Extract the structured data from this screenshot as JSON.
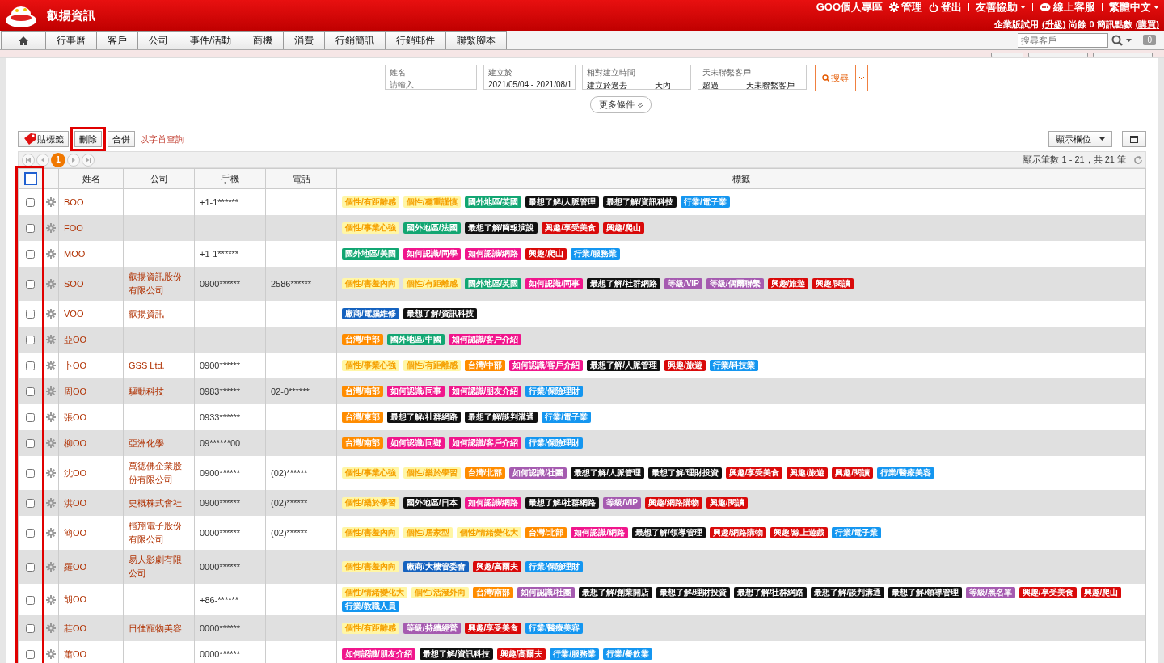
{
  "header": {
    "title": "叡揚資訊",
    "links": [
      {
        "label": "GOO個人專區",
        "kind": "link"
      },
      {
        "label": "管理",
        "kind": "link"
      },
      {
        "label": "登出",
        "kind": "link"
      },
      {
        "label": "友善協助",
        "kind": "dropdown"
      },
      {
        "label": "線上客服",
        "kind": "link"
      },
      {
        "label": "繁體中文",
        "kind": "dropdown"
      }
    ],
    "account": [
      {
        "label": "企業版試用",
        "link": false
      },
      {
        "label": "(升級)",
        "link": true
      },
      {
        "label": "尚餘 0 簡訊點數",
        "link": false
      },
      {
        "label": "(購買)",
        "link": true
      }
    ]
  },
  "nav": {
    "tabs": [
      {
        "label": "行事曆",
        "selected": false
      },
      {
        "label": "客戶",
        "selected": false
      },
      {
        "label": "公司",
        "selected": false
      },
      {
        "label": "事件/活動",
        "selected": false
      },
      {
        "label": "商機",
        "selected": false
      },
      {
        "label": "消費",
        "selected": false
      },
      {
        "label": "行銷簡訊",
        "selected": false
      },
      {
        "label": "行銷郵件",
        "selected": false
      },
      {
        "label": "聯繫腳本",
        "selected": false
      }
    ],
    "search": {
      "placeholder": "搜尋客戶"
    },
    "badge": "0"
  },
  "filters": [
    {
      "kind": "text",
      "label": "姓名",
      "placeholder": "請輸入"
    },
    {
      "kind": "value",
      "label": "建立於",
      "value": "2021/05/04 - 2021/08/1"
    },
    {
      "kind": "blank",
      "label": "相對建立時間",
      "before": "建立於過去",
      "after": "天內"
    },
    {
      "kind": "blank",
      "label": "天未聯繫客戶",
      "before": "超過",
      "after": "天未聯繫客戶"
    }
  ],
  "search_button": "搜尋",
  "more_conditions": "更多條件",
  "toolbar": {
    "buttons": [
      {
        "label": "貼標籤",
        "highlighted": false
      },
      {
        "label": "刪除",
        "highlighted": true
      },
      {
        "label": "合併",
        "highlighted": false
      }
    ],
    "link": "以字首查詢",
    "columns_button": "顯示欄位"
  },
  "pager": {
    "pages": [
      {
        "label": "1",
        "selected": true
      }
    ],
    "summary": "顯示筆數 1 - 21，共 21 筆"
  },
  "table": {
    "highlight_checkbox_column": true,
    "select_all_checked": false,
    "columns": [
      "姓名",
      "公司",
      "手機",
      "電話",
      "標籤"
    ],
    "rows": [
      {
        "checked": false,
        "name": "BOO",
        "company": "",
        "mobile": "+1-1******",
        "phone": "",
        "tags": [
          {
            "label": "個性/有距離感",
            "color": "#fff6a6"
          },
          {
            "label": "個性/穩重謹慎",
            "color": "#fff6a6"
          },
          {
            "label": "國外地區/英國",
            "color": "#12a672"
          },
          {
            "label": "最想了解/人脈管理",
            "color": "#111111"
          },
          {
            "label": "最想了解/資訊科技",
            "color": "#111111"
          },
          {
            "label": "行業/電子業",
            "color": "#1496f0"
          }
        ]
      },
      {
        "checked": false,
        "name": "FOO",
        "company": "",
        "mobile": "",
        "phone": "",
        "tags": [
          {
            "label": "個性/事業心強",
            "color": "#fff6a6"
          },
          {
            "label": "國外地區/法國",
            "color": "#12a672"
          },
          {
            "label": "最想了解/簡報演說",
            "color": "#111111"
          },
          {
            "label": "興趣/享受美食",
            "color": "#d90a0a"
          },
          {
            "label": "興趣/爬山",
            "color": "#d90a0a"
          }
        ]
      },
      {
        "checked": false,
        "name": "MOO",
        "company": "",
        "mobile": "+1-1******",
        "phone": "",
        "tags": [
          {
            "label": "國外地區/美國",
            "color": "#12a672"
          },
          {
            "label": "如何認識/同學",
            "color": "#f0168c"
          },
          {
            "label": "如何認識/網路",
            "color": "#f0168c"
          },
          {
            "label": "興趣/爬山",
            "color": "#d90a0a"
          },
          {
            "label": "行業/服務業",
            "color": "#1496f0"
          }
        ]
      },
      {
        "checked": false,
        "name": "SOO",
        "company": "叡揚資訊股份有限公司",
        "mobile": "0900******",
        "phone": "2586******",
        "tags": [
          {
            "label": "個性/害羞內向",
            "color": "#fff6a6"
          },
          {
            "label": "個性/有距離感",
            "color": "#fff6a6"
          },
          {
            "label": "國外地區/英國",
            "color": "#12a672"
          },
          {
            "label": "如何認識/同事",
            "color": "#f0168c"
          },
          {
            "label": "最想了解/社群網路",
            "color": "#111111"
          },
          {
            "label": "等級/VIP",
            "color": "#a55bb0"
          },
          {
            "label": "等級/偶爾聯繫",
            "color": "#a55bb0"
          },
          {
            "label": "興趣/旅遊",
            "color": "#d90a0a"
          },
          {
            "label": "興趣/閱讀",
            "color": "#d90a0a"
          }
        ]
      },
      {
        "checked": false,
        "name": "VOO",
        "company": "叡揚資訊",
        "mobile": "",
        "phone": "",
        "tags": [
          {
            "label": "廠商/電腦維修",
            "color": "#1562bf"
          },
          {
            "label": "最想了解/資訊科技",
            "color": "#111111"
          }
        ]
      },
      {
        "checked": false,
        "name": "亞OO",
        "company": "",
        "mobile": "",
        "phone": "",
        "tags": [
          {
            "label": "台灣/中部",
            "color": "#ff8c00"
          },
          {
            "label": "國外地區/中國",
            "color": "#12a672"
          },
          {
            "label": "如何認識/客戶介紹",
            "color": "#f0168c"
          }
        ]
      },
      {
        "checked": false,
        "name": "卜OO",
        "company": "GSS Ltd.",
        "mobile": "0900******",
        "phone": "",
        "tags": [
          {
            "label": "個性/事業心強",
            "color": "#fff6a6"
          },
          {
            "label": "個性/有距離感",
            "color": "#fff6a6"
          },
          {
            "label": "台灣/中部",
            "color": "#ff8c00"
          },
          {
            "label": "如何認識/客戶介紹",
            "color": "#f0168c"
          },
          {
            "label": "最想了解/人脈管理",
            "color": "#111111"
          },
          {
            "label": "興趣/旅遊",
            "color": "#d90a0a"
          },
          {
            "label": "行業/科技業",
            "color": "#1496f0"
          }
        ]
      },
      {
        "checked": false,
        "name": "周OO",
        "company": "驅動科技",
        "mobile": "0983******",
        "phone": "02-0******",
        "tags": [
          {
            "label": "台灣/南部",
            "color": "#ff8c00"
          },
          {
            "label": "如何認識/同事",
            "color": "#f0168c"
          },
          {
            "label": "如何認識/朋友介紹",
            "color": "#f0168c"
          },
          {
            "label": "行業/保險理財",
            "color": "#1496f0"
          }
        ]
      },
      {
        "checked": false,
        "name": "張OO",
        "company": "",
        "mobile": "0933******",
        "phone": "",
        "tags": [
          {
            "label": "台灣/東部",
            "color": "#ff8c00"
          },
          {
            "label": "最想了解/社群網路",
            "color": "#111111"
          },
          {
            "label": "最想了解/談判溝通",
            "color": "#111111"
          },
          {
            "label": "行業/電子業",
            "color": "#1496f0"
          }
        ]
      },
      {
        "checked": false,
        "name": "柳OO",
        "company": "亞洲化學",
        "mobile": "09******00",
        "phone": "",
        "tags": [
          {
            "label": "台灣/南部",
            "color": "#ff8c00"
          },
          {
            "label": "如何認識/同鄉",
            "color": "#f0168c"
          },
          {
            "label": "如何認識/客戶介紹",
            "color": "#f0168c"
          },
          {
            "label": "行業/保險理財",
            "color": "#1496f0"
          }
        ]
      },
      {
        "checked": false,
        "name": "沈OO",
        "company": "萬德佛企業股份有限公司",
        "mobile": "0900******",
        "phone": "(02)******",
        "tags": [
          {
            "label": "個性/事業心強",
            "color": "#fff6a6"
          },
          {
            "label": "個性/樂於學習",
            "color": "#fff6a6"
          },
          {
            "label": "台灣/北部",
            "color": "#ff8c00"
          },
          {
            "label": "如何認識/社團",
            "color": "#a55bb0"
          },
          {
            "label": "最想了解/人脈管理",
            "color": "#111111"
          },
          {
            "label": "最想了解/理財投資",
            "color": "#111111"
          },
          {
            "label": "興趣/享受美食",
            "color": "#d90a0a"
          },
          {
            "label": "興趣/旅遊",
            "color": "#d90a0a"
          },
          {
            "label": "興趣/閱讀",
            "color": "#d90a0a"
          },
          {
            "label": "行業/醫療美容",
            "color": "#1496f0"
          }
        ]
      },
      {
        "checked": false,
        "name": "洪OO",
        "company": "史概株式會社",
        "mobile": "0900******",
        "phone": "(02)******",
        "tags": [
          {
            "label": "個性/樂於學習",
            "color": "#fff6a6"
          },
          {
            "label": "國外地區/日本",
            "color": "#111111"
          },
          {
            "label": "如何認識/網路",
            "color": "#f0168c"
          },
          {
            "label": "最想了解/社群網路",
            "color": "#111111"
          },
          {
            "label": "等級/VIP",
            "color": "#a55bb0"
          },
          {
            "label": "興趣/網路購物",
            "color": "#d90a0a"
          },
          {
            "label": "興趣/閱讀",
            "color": "#d90a0a"
          }
        ]
      },
      {
        "checked": false,
        "name": "簡OO",
        "company": "楷翔電子股份有限公司",
        "mobile": "0000******",
        "phone": "(02)******",
        "tags": [
          {
            "label": "個性/害羞內向",
            "color": "#fff6a6"
          },
          {
            "label": "個性/居家型",
            "color": "#fff6a6"
          },
          {
            "label": "個性/情緒變化大",
            "color": "#fff6a6"
          },
          {
            "label": "台灣/北部",
            "color": "#ff8c00"
          },
          {
            "label": "如何認識/網路",
            "color": "#f0168c"
          },
          {
            "label": "最想了解/領導管理",
            "color": "#111111"
          },
          {
            "label": "興趣/網路購物",
            "color": "#d90a0a"
          },
          {
            "label": "興趣/線上遊戲",
            "color": "#d90a0a"
          },
          {
            "label": "行業/電子業",
            "color": "#1496f0"
          }
        ]
      },
      {
        "checked": false,
        "name": "羅OO",
        "company": "易人影劇有限公司",
        "mobile": "0000******",
        "phone": "",
        "tags": [
          {
            "label": "個性/害羞內向",
            "color": "#fff6a6"
          },
          {
            "label": "廠商/大樓管委會",
            "color": "#1562bf"
          },
          {
            "label": "興趣/高爾夫",
            "color": "#d90a0a"
          },
          {
            "label": "行業/保險理財",
            "color": "#1496f0"
          }
        ]
      },
      {
        "checked": false,
        "name": "胡OO",
        "company": "",
        "mobile": "+86-******",
        "phone": "",
        "tags": [
          {
            "label": "個性/情緒變化大",
            "color": "#fff6a6"
          },
          {
            "label": "個性/活潑外向",
            "color": "#fff6a6"
          },
          {
            "label": "台灣/南部",
            "color": "#ff8c00"
          },
          {
            "label": "如何認識/社團",
            "color": "#a55bb0"
          },
          {
            "label": "最想了解/創業開店",
            "color": "#111111"
          },
          {
            "label": "最想了解/理財投資",
            "color": "#111111"
          },
          {
            "label": "最想了解/社群網路",
            "color": "#111111"
          },
          {
            "label": "最想了解/談判溝通",
            "color": "#111111"
          },
          {
            "label": "最想了解/領導管理",
            "color": "#111111"
          },
          {
            "label": "等級/黑名單",
            "color": "#a55bb0"
          },
          {
            "label": "興趣/享受美食",
            "color": "#d90a0a"
          },
          {
            "label": "興趣/爬山",
            "color": "#d90a0a"
          },
          {
            "label": "行業/教職人員",
            "color": "#1496f0"
          }
        ]
      },
      {
        "checked": false,
        "name": "莊OO",
        "company": "日佳寵物美容",
        "mobile": "0000******",
        "phone": "",
        "tags": [
          {
            "label": "個性/有距離感",
            "color": "#fff6a6"
          },
          {
            "label": "等級/持續經營",
            "color": "#a55bb0"
          },
          {
            "label": "興趣/享受美食",
            "color": "#d90a0a"
          },
          {
            "label": "行業/醫療美容",
            "color": "#1496f0"
          }
        ]
      },
      {
        "checked": false,
        "name": "蕭OO",
        "company": "",
        "mobile": "0000******",
        "phone": "",
        "tags": [
          {
            "label": "如何認識/朋友介紹",
            "color": "#f0168c"
          },
          {
            "label": "最想了解/資訊科技",
            "color": "#111111"
          },
          {
            "label": "興趣/高爾夫",
            "color": "#d90a0a"
          },
          {
            "label": "行業/服務業",
            "color": "#1496f0"
          },
          {
            "label": "行業/餐飲業",
            "color": "#1496f0"
          }
        ]
      }
    ]
  }
}
